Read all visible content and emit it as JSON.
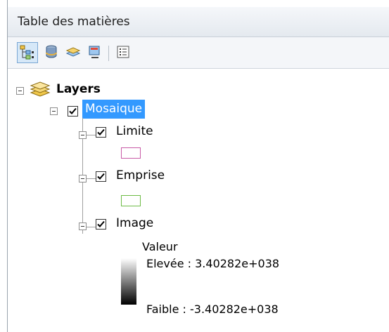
{
  "window": {
    "title": "Table des matières"
  },
  "toolbar": {
    "buttons": [
      {
        "name": "list-by-drawing-order",
        "icon": "drawing-order-icon",
        "active": true
      },
      {
        "name": "list-by-source",
        "icon": "database-icon",
        "active": false
      },
      {
        "name": "list-by-visibility",
        "icon": "layers-visibility-icon",
        "active": false
      },
      {
        "name": "list-by-selection",
        "icon": "selection-icon",
        "active": false
      },
      {
        "name": "options",
        "icon": "options-list-icon",
        "active": false
      }
    ]
  },
  "tree": {
    "root": {
      "label": "Layers",
      "icon": "layers-stack-icon",
      "expanded": true
    },
    "group": {
      "label": "Mosaique",
      "checked": true,
      "selected": true,
      "expanded": true
    },
    "layers": [
      {
        "label": "Limite",
        "checked": true,
        "expanded": true,
        "symbol_outline": "#c85aa6"
      },
      {
        "label": "Emprise",
        "checked": true,
        "expanded": true,
        "symbol_outline": "#6dbb45"
      },
      {
        "label": "Image",
        "checked": true,
        "expanded": true
      }
    ],
    "raster_legend": {
      "heading": "Valeur",
      "high_label": "Elevée : 3.40282e+038",
      "low_label": "Faible : -3.40282e+038",
      "gradient_top": "#ffffff",
      "gradient_bottom": "#000000"
    }
  },
  "colors": {
    "selection_bg": "#3399ff",
    "selection_text": "#ffffff",
    "title_bar": "#e9edf2"
  }
}
